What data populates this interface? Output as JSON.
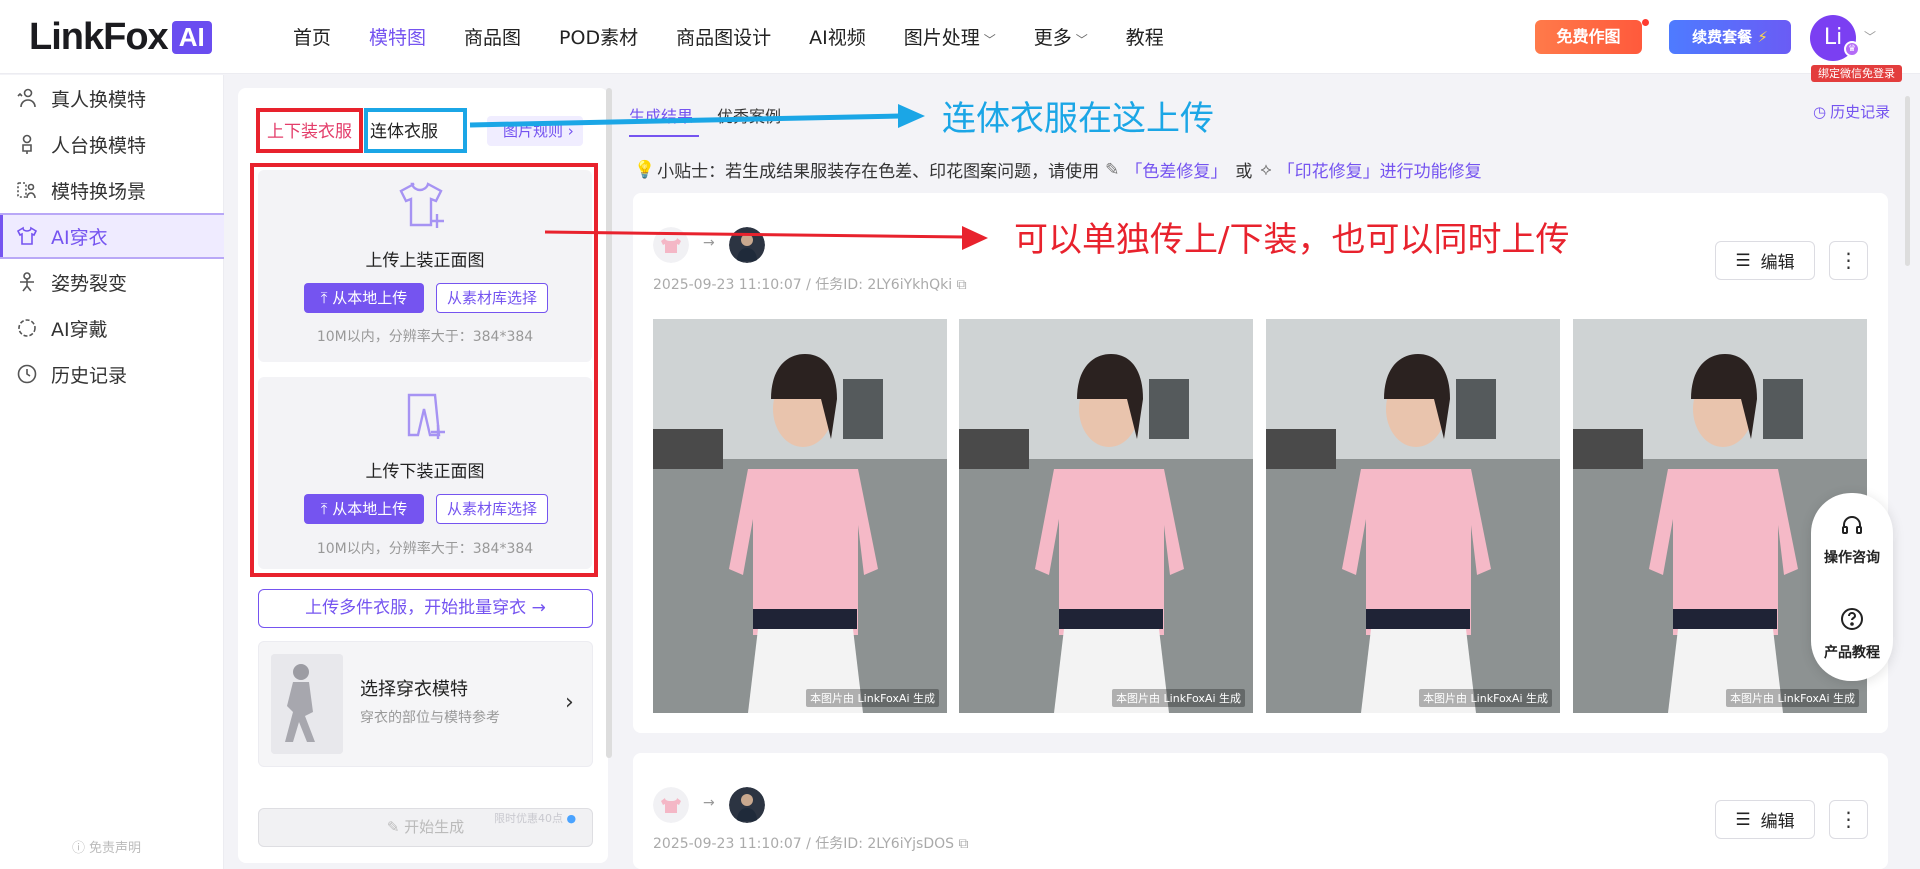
{
  "header": {
    "logo_text": "LinkFox",
    "logo_badge": "AI",
    "nav": [
      {
        "label": "首页"
      },
      {
        "label": "模特图"
      },
      {
        "label": "商品图"
      },
      {
        "label": "POD素材"
      },
      {
        "label": "商品图设计"
      },
      {
        "label": "AI视频"
      },
      {
        "label": "图片处理"
      },
      {
        "label": "更多"
      },
      {
        "label": "教程"
      }
    ],
    "free_button": "免费作图",
    "renew_button": "续费套餐",
    "avatar_text": "Li",
    "bind_tag": "绑定微信免登录"
  },
  "sidebar": {
    "items": [
      {
        "label": "真人换模特"
      },
      {
        "label": "人台换模特"
      },
      {
        "label": "模特换场景"
      },
      {
        "label": "AI穿衣"
      },
      {
        "label": "姿势裂变"
      },
      {
        "label": "AI穿戴"
      },
      {
        "label": "历史记录"
      }
    ],
    "disclaimer": "免责声明"
  },
  "panel": {
    "tab_top_bottom": "上下装衣服",
    "tab_onepiece": "连体衣服",
    "rules_link": "图片规则",
    "upload_top": {
      "title": "上传上装正面图",
      "local": "从本地上传",
      "library": "从素材库选择",
      "hint": "10M以内，分辨率大于：384*384"
    },
    "upload_bottom": {
      "title": "上传下装正面图",
      "local": "从本地上传",
      "library": "从素材库选择",
      "hint": "10M以内，分辨率大于：384*384"
    },
    "batch_button": "上传多件衣服，开始批量穿衣",
    "model_title": "选择穿衣模特",
    "model_sub": "穿衣的部位与模特参考",
    "generate": "开始生成",
    "generate_promo": "限时优惠40点"
  },
  "results": {
    "tab_results": "生成结果",
    "tab_cases": "优秀案例",
    "history": "历史记录",
    "tip_prefix": "小贴士：若生成结果服装存在色差、印花图案问题，请使用",
    "tip_color_fix": "「色差修复」",
    "tip_or": "或",
    "tip_print_fix": "「印花修复」进行功能修复",
    "cards": [
      {
        "meta": "2025-09-23 11:10:07 / 任务ID: 2LY6iYkhQki",
        "edit": "编辑"
      },
      {
        "meta": "2025-09-23 11:10:07 / 任务ID: 2LY6iYjsDOS",
        "edit": "编辑"
      }
    ],
    "watermark": "本图片由 LinkFoxAi 生成",
    "float_consult": "操作咨询",
    "float_tutorial": "产品教程"
  },
  "annotations": {
    "onepiece_note": "连体衣服在这上传",
    "separate_note": "可以单独传上/下装，也可以同时上传",
    "color_red": "#e8222d",
    "color_blue": "#1ba6e6"
  },
  "colors": {
    "accent": "#7554f0",
    "free_btn": "#ff6a45",
    "renew_btn": "#5a6cf8"
  }
}
